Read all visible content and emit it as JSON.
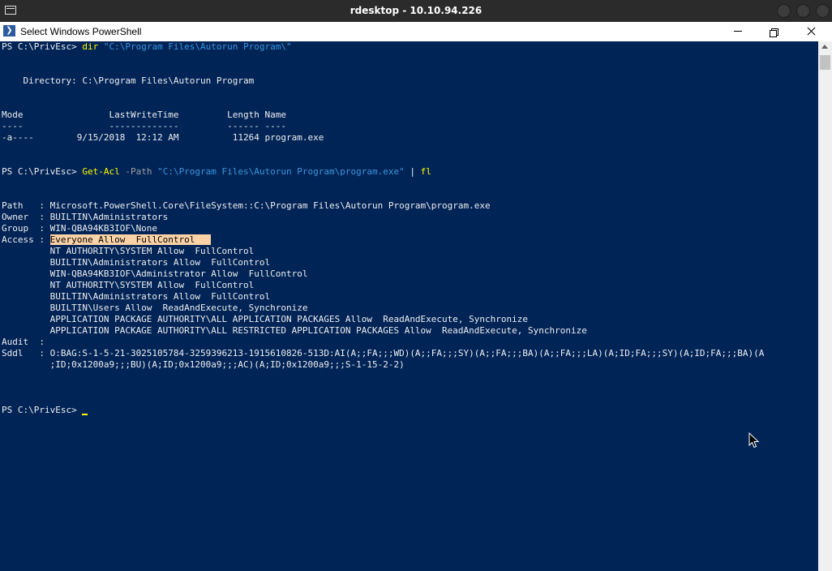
{
  "outer_window": {
    "title": "rdesktop - 10.10.94.226"
  },
  "ps_window": {
    "title": "Select Windows PowerShell",
    "icon_glyph": "❯"
  },
  "console": {
    "l1": {
      "prompt": "PS C:\\PrivEsc> ",
      "cmd": "dir",
      "arg": " \"C:\\Program Files\\Autorun Program\\\""
    },
    "l2": "    Directory: C:\\Program Files\\Autorun Program",
    "l3": "Mode                LastWriteTime         Length Name",
    "l4": "----                -------------         ------ ----",
    "l5": "-a----        9/15/2018  12:12 AM          11264 program.exe",
    "l6": {
      "prompt": "PS C:\\PrivEsc> ",
      "cmd": "Get-Acl",
      "param": " -Path",
      "arg": " \"C:\\Program Files\\Autorun Program\\program.exe\"",
      "pipe": " | ",
      "cmd2": "fl"
    },
    "l7": "Path   : Microsoft.PowerShell.Core\\FileSystem::C:\\Program Files\\Autorun Program\\program.exe",
    "l8": "Owner  : BUILTIN\\Administrators",
    "l9": "Group  : WIN-QBA94KB3IOF\\None",
    "l10": {
      "label": "Access : ",
      "highlight": "Everyone Allow  FullControl   "
    },
    "l11": "         NT AUTHORITY\\SYSTEM Allow  FullControl",
    "l12": "         BUILTIN\\Administrators Allow  FullControl",
    "l13": "         WIN-QBA94KB3IOF\\Administrator Allow  FullControl",
    "l14": "         NT AUTHORITY\\SYSTEM Allow  FullControl",
    "l15": "         BUILTIN\\Administrators Allow  FullControl",
    "l16": "         BUILTIN\\Users Allow  ReadAndExecute, Synchronize",
    "l17": "         APPLICATION PACKAGE AUTHORITY\\ALL APPLICATION PACKAGES Allow  ReadAndExecute, Synchronize",
    "l18": "         APPLICATION PACKAGE AUTHORITY\\ALL RESTRICTED APPLICATION PACKAGES Allow  ReadAndExecute, Synchronize",
    "l19": "Audit  :",
    "l20": "Sddl   : O:BAG:S-1-5-21-3025105784-3259396213-1915610826-513D:AI(A;;FA;;;WD)(A;;FA;;;SY)(A;;FA;;;BA)(A;;FA;;;LA)(A;ID;FA;;;SY)(A;ID;FA;;;BA)(A",
    "l21": "         ;ID;0x1200a9;;;BU)(A;ID;0x1200a9;;;AC)(A;ID;0x1200a9;;;S-1-15-2-2)",
    "l22": {
      "prompt": "PS C:\\PrivEsc> "
    }
  },
  "colors": {
    "console_bg": "#012456",
    "command": "#ffff00",
    "string": "#3a96dd",
    "highlight": "#fbd2a6"
  }
}
